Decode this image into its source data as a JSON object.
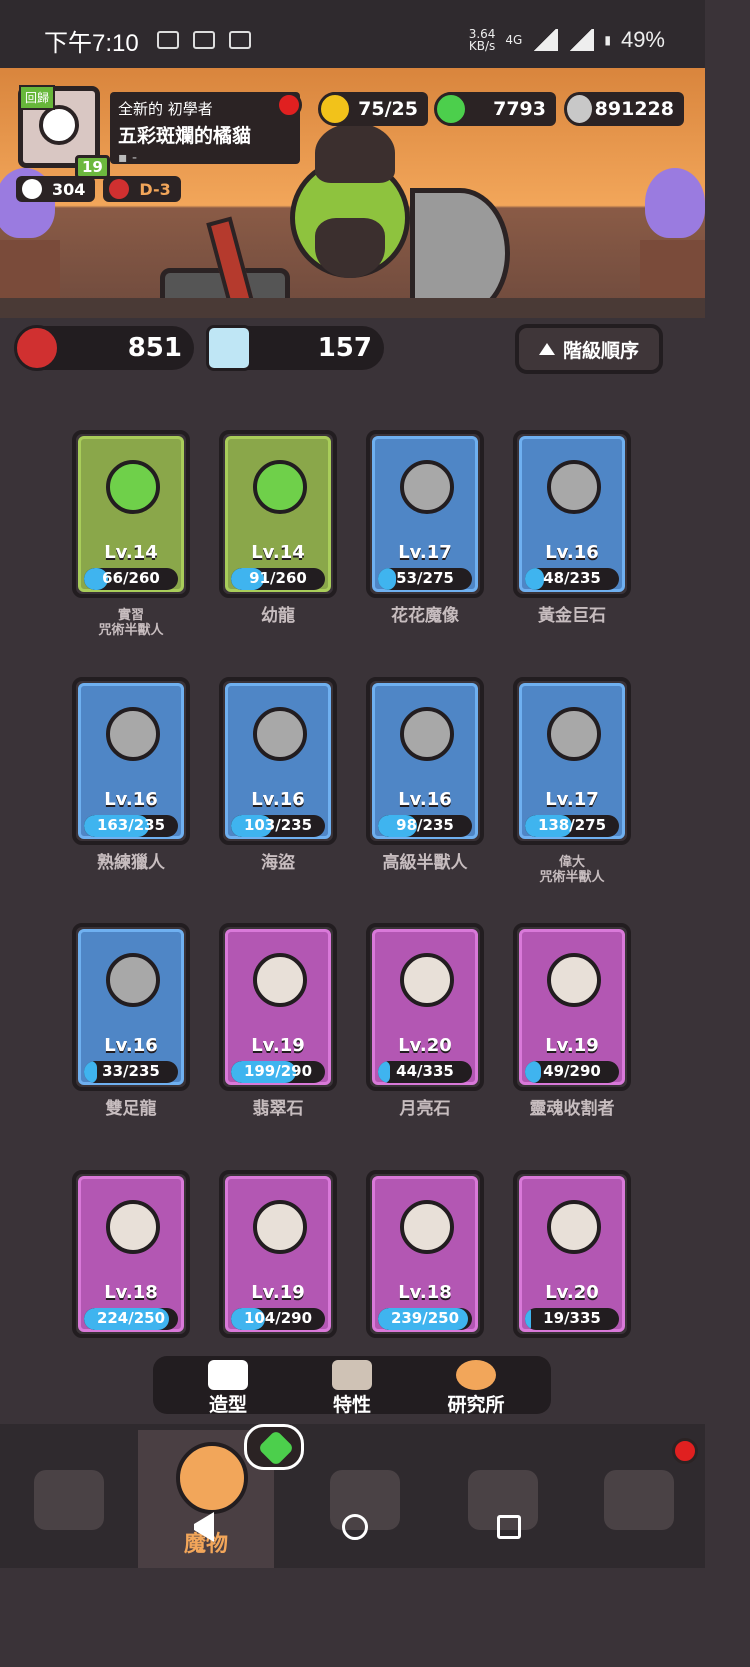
{
  "status_bar": {
    "time": "下午7:10",
    "speed_value": "3.64",
    "speed_unit": "KB/s",
    "network": "4G",
    "battery": "49%"
  },
  "player": {
    "back_tag": "回歸",
    "title": "全新的 初學者",
    "name": "五彩斑斕的橘貓",
    "guild": "-",
    "level": "19",
    "likes": "304",
    "dungeon": "D-3"
  },
  "currencies": {
    "energy": "75/25",
    "gems": "7793",
    "coins": "891228"
  },
  "resources": {
    "red_orbs": "851",
    "crystals": "157",
    "sort_label": "階級順序"
  },
  "monsters": [
    {
      "name": "實習\n咒術半獸人",
      "level": "Lv.14",
      "progress": "66/260",
      "fraction": 0.25,
      "rarity": "green"
    },
    {
      "name": "幼龍",
      "level": "Lv.14",
      "progress": "91/260",
      "fraction": 0.35,
      "rarity": "green"
    },
    {
      "name": "花花魔像",
      "level": "Lv.17",
      "progress": "53/275",
      "fraction": 0.19,
      "rarity": "blue"
    },
    {
      "name": "黃金巨石",
      "level": "Lv.16",
      "progress": "48/235",
      "fraction": 0.2,
      "rarity": "blue"
    },
    {
      "name": "熟練獵人",
      "level": "Lv.16",
      "progress": "163/235",
      "fraction": 0.69,
      "rarity": "blue"
    },
    {
      "name": "海盜",
      "level": "Lv.16",
      "progress": "103/235",
      "fraction": 0.44,
      "rarity": "blue"
    },
    {
      "name": "高級半獸人",
      "level": "Lv.16",
      "progress": "98/235",
      "fraction": 0.42,
      "rarity": "blue"
    },
    {
      "name": "偉大\n咒術半獸人",
      "level": "Lv.17",
      "progress": "138/275",
      "fraction": 0.5,
      "rarity": "blue"
    },
    {
      "name": "雙足龍",
      "level": "Lv.16",
      "progress": "33/235",
      "fraction": 0.14,
      "rarity": "blue"
    },
    {
      "name": "翡翠石",
      "level": "Lv.19",
      "progress": "199/290",
      "fraction": 0.69,
      "rarity": "purple"
    },
    {
      "name": "月亮石",
      "level": "Lv.20",
      "progress": "44/335",
      "fraction": 0.13,
      "rarity": "purple"
    },
    {
      "name": "靈魂收割者",
      "level": "Lv.19",
      "progress": "49/290",
      "fraction": 0.17,
      "rarity": "purple"
    },
    {
      "name": "",
      "level": "Lv.18",
      "progress": "224/250",
      "fraction": 0.9,
      "rarity": "purple"
    },
    {
      "name": "",
      "level": "Lv.19",
      "progress": "104/290",
      "fraction": 0.36,
      "rarity": "purple"
    },
    {
      "name": "",
      "level": "Lv.18",
      "progress": "239/250",
      "fraction": 0.96,
      "rarity": "purple"
    },
    {
      "name": "",
      "level": "Lv.20",
      "progress": "19/335",
      "fraction": 0.06,
      "rarity": "purple"
    }
  ],
  "subnav": {
    "outfit": "造型",
    "traits": "特性",
    "lab": "研究所"
  },
  "bottom_nav": {
    "active_label": "魔物"
  },
  "colors": {
    "green_card": "#8aa74a",
    "blue_card": "#4f86c6",
    "purple_card": "#b357b3",
    "progress_fill": "#3fb4ef",
    "accent": "#f2a65a"
  }
}
